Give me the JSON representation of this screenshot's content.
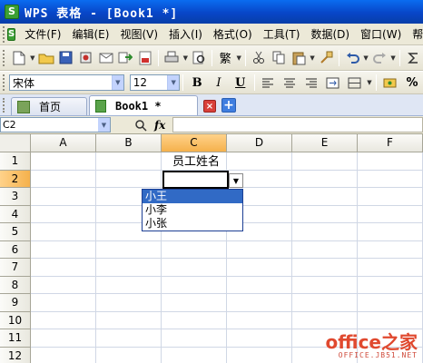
{
  "window": {
    "title": "WPS 表格 - [Book1 *]",
    "logo_letter": "S"
  },
  "menu": [
    "文件(F)",
    "编辑(E)",
    "视图(V)",
    "插入(I)",
    "格式(O)",
    "工具(T)",
    "数据(D)",
    "窗口(W)",
    "帮助"
  ],
  "toolbar": {
    "style_label": "繁"
  },
  "format": {
    "font_name": "宋体",
    "font_size": "12",
    "bold": "B",
    "italic": "I",
    "underline": "U",
    "percent": "%"
  },
  "tabs": {
    "home": "首页",
    "doc": "Book1 *",
    "close": "×",
    "new": "+"
  },
  "formula_bar": {
    "name_box": "C2",
    "fx": "fx",
    "formula": ""
  },
  "sheet": {
    "columns": [
      "A",
      "B",
      "C",
      "D",
      "E",
      "F"
    ],
    "selected_column": "C",
    "rows": [
      "1",
      "2",
      "3",
      "4",
      "5",
      "6",
      "7",
      "8",
      "9",
      "10",
      "11",
      "12"
    ],
    "selected_row": "2",
    "cells": {
      "C1": "员工姓名",
      "C2": ""
    }
  },
  "dropdown": {
    "options": [
      "小王",
      "小李",
      "小张"
    ],
    "highlighted": "小王"
  },
  "watermark": {
    "main": "office之家",
    "sub": "OFFICE.JB51.NET"
  }
}
